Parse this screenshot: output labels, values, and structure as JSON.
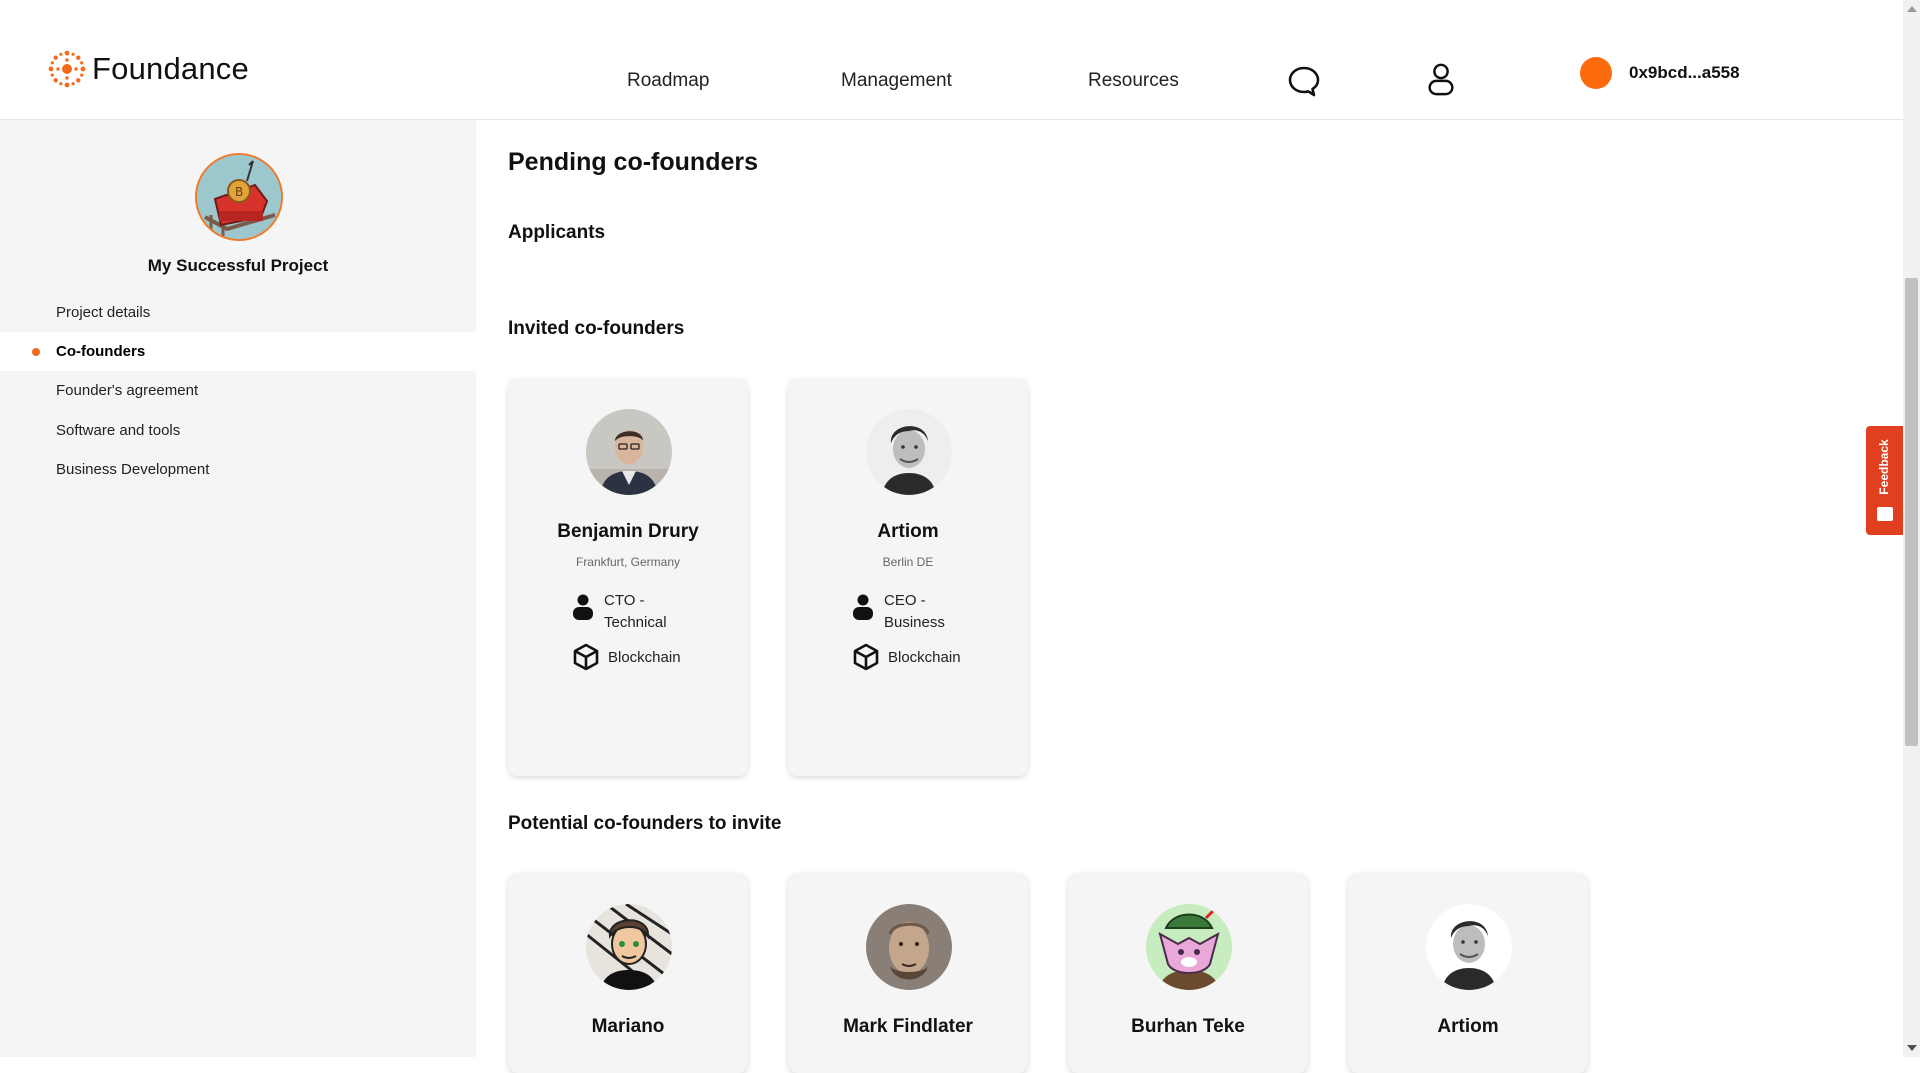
{
  "header": {
    "brand": "Foundance",
    "nav": [
      "Roadmap",
      "Management",
      "Resources"
    ],
    "wallet_address": "0x9bcd...a558",
    "accent": "#fb6a0c"
  },
  "sidebar": {
    "project_name": "My Successful Project",
    "items": [
      {
        "label": "Project details"
      },
      {
        "label": "Co-founders"
      },
      {
        "label": "Founder's agreement"
      },
      {
        "label": "Software and tools"
      },
      {
        "label": "Business Development"
      }
    ],
    "active_item": "Co-founders"
  },
  "main": {
    "title": "Pending co-founders",
    "applicants_heading": "Applicants",
    "invited_heading": "Invited co-founders",
    "invited": [
      {
        "name": "Benjamin Drury",
        "location": "Frankfurt, Germany",
        "role": "CTO - Technical",
        "industry": "Blockchain"
      },
      {
        "name": "Artiom",
        "location": "Berlin DE",
        "role": "CEO - Business",
        "industry": "Blockchain"
      }
    ],
    "potential_heading": "Potential co-founders to invite",
    "potential": [
      {
        "name": "Mariano"
      },
      {
        "name": "Mark Findlater"
      },
      {
        "name": "Burhan Teke"
      },
      {
        "name": "Artiom"
      }
    ]
  },
  "feedback": {
    "label": "Feedback"
  }
}
